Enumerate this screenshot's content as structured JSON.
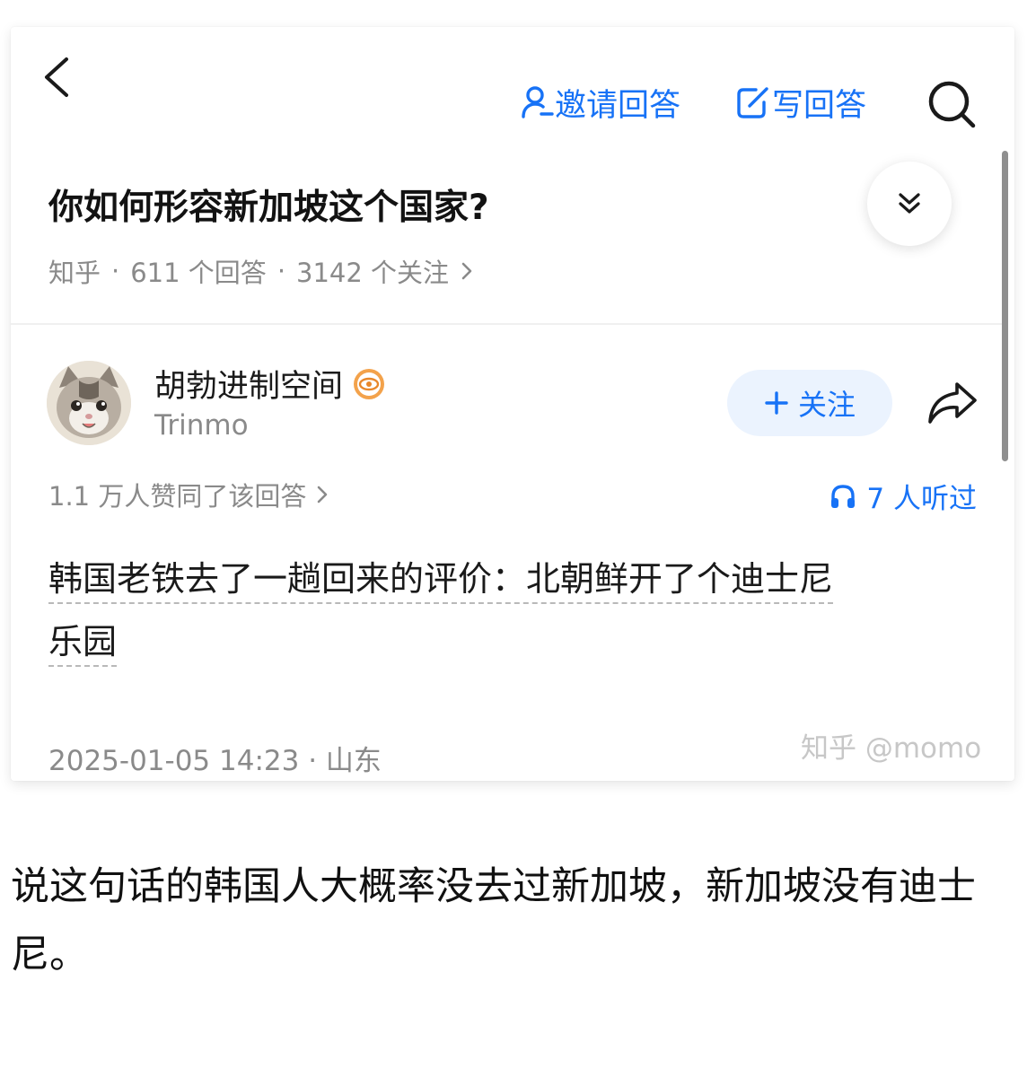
{
  "header": {
    "invite_label": "邀请回答",
    "write_label": "写回答"
  },
  "question": {
    "title": "你如何形容新加坡这个国家?",
    "source": "知乎",
    "answers": "611 个回答",
    "followers": "3142 个关注"
  },
  "author": {
    "name": "胡勃进制空间",
    "handle": "Trinmo",
    "follow_label": "关注"
  },
  "answer": {
    "likes": "1.1 万人赞同了该回答",
    "listens": "7 人听过",
    "content_line1": "韩国老铁去了一趟回来的评价：北朝鲜开了个迪士尼",
    "content_line2": "乐园",
    "timestamp": "2025-01-05 14:23 · 山东"
  },
  "watermark": "知乎 @momo",
  "caption": "说这句话的韩国人大概率没去过新加坡，新加坡没有迪士尼。",
  "colors": {
    "accent": "#1772f6",
    "muted": "#8a8a8a",
    "follow_bg": "#ebf3fe"
  }
}
